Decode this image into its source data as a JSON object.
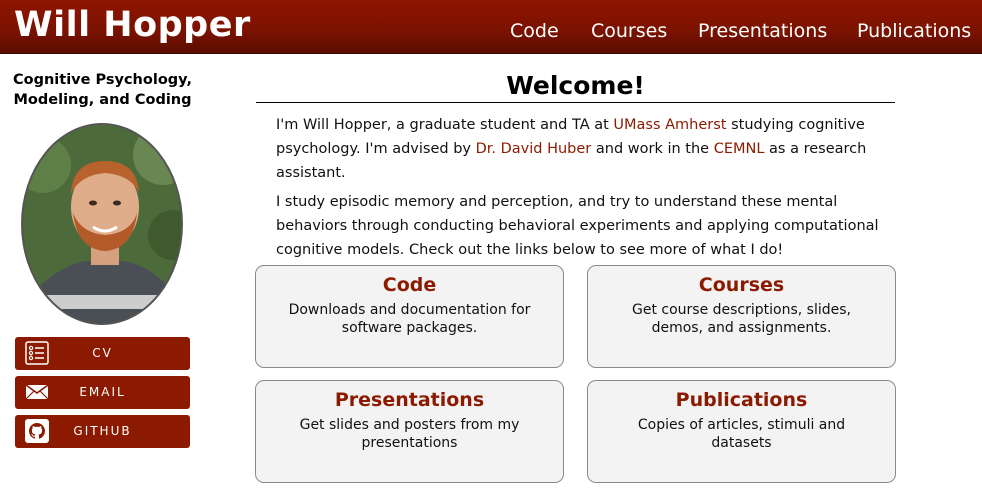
{
  "header": {
    "title": "Will Hopper",
    "nav": [
      "Code",
      "Courses",
      "Presentations",
      "Publications"
    ]
  },
  "sidebar": {
    "tagline_line1": "Cognitive Psychology,",
    "tagline_line2": "Modeling, and Coding",
    "buttons": [
      {
        "label": "CV",
        "icon": "cv-list-icon"
      },
      {
        "label": "EMAIL",
        "icon": "envelope-icon"
      },
      {
        "label": "GITHUB",
        "icon": "github-icon"
      }
    ]
  },
  "main": {
    "heading": "Welcome!",
    "p1": {
      "t1": "I'm Will Hopper, a graduate student and TA at ",
      "link1": "UMass Amherst",
      "t2": " studying cognitive psychology. I'm advised by ",
      "link2": "Dr. David Huber",
      "t3": " and work in the ",
      "link3": "CEMNL",
      "t4": " as a research assistant."
    },
    "p2": "I study episodic memory and perception, and try to understand these mental behaviors through conducting behavioral experiments and applying computational cognitive models. Check out the links below to see more of what I do!",
    "cards": [
      {
        "title": "Code",
        "desc": "Downloads and documentation for software packages."
      },
      {
        "title": "Courses",
        "desc": "Get course descriptions, slides, demos, and assignments."
      },
      {
        "title": "Presentations",
        "desc": "Get slides and posters from my presentations"
      },
      {
        "title": "Publications",
        "desc": "Copies of articles, stimuli and datasets"
      }
    ]
  },
  "colors": {
    "brand": "#8b1a00",
    "header_top": "#8e1500",
    "card_bg": "#f3f3f3"
  }
}
